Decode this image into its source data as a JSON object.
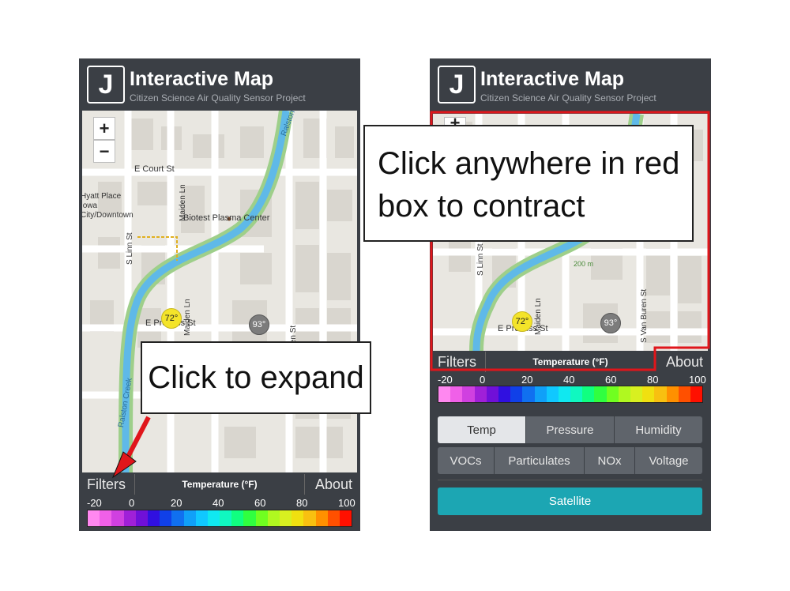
{
  "app": {
    "logo_letter": "J",
    "title": "Interactive Map",
    "subtitle": "Citizen Science Air Quality Sensor Project"
  },
  "map": {
    "zoom_in": "+",
    "zoom_out": "−",
    "streets": {
      "court": "E Court St",
      "prentiss": "E Prentiss St",
      "linn": "S Linn St",
      "maiden": "Maiden Ln",
      "van_buren": "S Van Buren St",
      "ralston": "Ralston Creek",
      "biotest": "Biotest Plasma Center",
      "hyatt": "Hyatt Place Iowa City/Downtown",
      "path_200": "200 m"
    },
    "sensors": [
      {
        "label": "72°",
        "color": "#f4e42a"
      },
      {
        "label": "93°",
        "color": "#7c7c7c"
      }
    ]
  },
  "toolbar": {
    "filters": "Filters",
    "legend_title": "Temperature (°F)",
    "about": "About"
  },
  "scale": {
    "ticks": [
      "-20",
      "0",
      "20",
      "40",
      "60",
      "80",
      "100"
    ],
    "colors": [
      "#ff88f0",
      "#f060e8",
      "#d040e0",
      "#a020d8",
      "#7010d8",
      "#3010e0",
      "#1040e8",
      "#1070f0",
      "#10a0f8",
      "#10c8ff",
      "#10e8f0",
      "#10f8c0",
      "#10ff80",
      "#30ff40",
      "#70ff20",
      "#b0f820",
      "#d8f020",
      "#f0e010",
      "#f8c010",
      "#ff9000",
      "#ff5000",
      "#ff1000"
    ]
  },
  "expanded_panel": {
    "tabs_row1": [
      {
        "label": "Temp",
        "selected": true
      },
      {
        "label": "Pressure",
        "selected": false
      },
      {
        "label": "Humidity",
        "selected": false
      }
    ],
    "tabs_row2": [
      {
        "label": "VOCs"
      },
      {
        "label": "Particulates"
      },
      {
        "label": "NOx"
      },
      {
        "label": "Voltage"
      }
    ],
    "satellite": "Satellite"
  },
  "annotations": {
    "expand": "Click to expand",
    "contract": "Click anywhere in red box to contract",
    "arrow_color": "#e0161b",
    "box_color": "#e0161b"
  }
}
